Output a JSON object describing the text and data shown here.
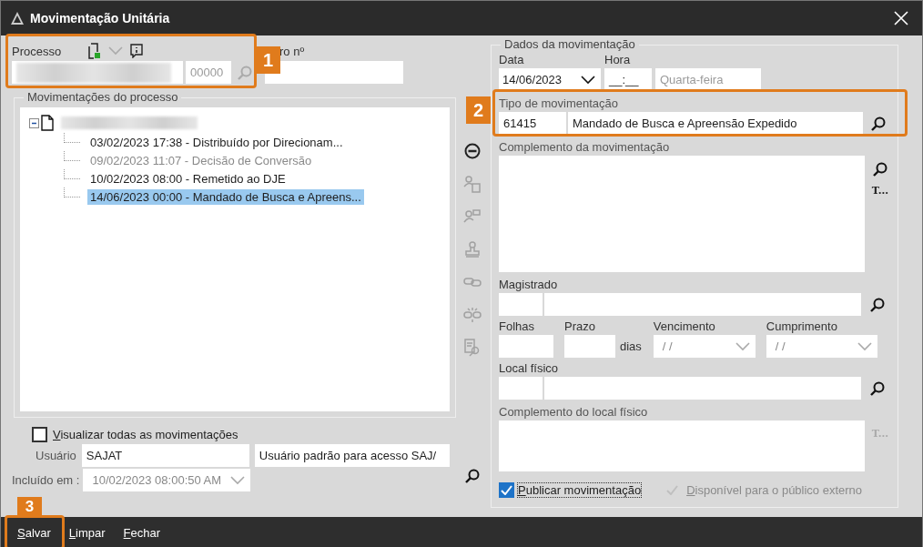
{
  "window": {
    "title": "Movimentação Unitária"
  },
  "processo": {
    "label": "Processo",
    "number_suffix": "00000",
    "outro_label": "ro nº",
    "annotation": "1"
  },
  "movimentacoes": {
    "title": "Movimentações do processo",
    "expanded": true,
    "items": [
      {
        "text": "03/02/2023 17:38 - Distribuído por Direcionam...",
        "selected": false,
        "disabled": false
      },
      {
        "text": "09/02/2023 11:07 - Decisão de Conversão",
        "selected": false,
        "disabled": true
      },
      {
        "text": "10/02/2023 08:00 - Remetido ao DJE",
        "selected": false,
        "disabled": false
      },
      {
        "text": "14/06/2023 00:00 - Mandado de Busca e Apreens...",
        "selected": true,
        "disabled": false
      }
    ]
  },
  "visualizar_todas": {
    "label": "Visualizar todas as movimentações",
    "checked": false
  },
  "usuario": {
    "label": "Usuário",
    "code": "SAJAT",
    "name": "Usuário padrão para acesso SAJ/"
  },
  "incluido": {
    "label": "Incluído em :",
    "value": "10/02/2023 08:00:50 AM"
  },
  "side_tools": [
    {
      "kind": "remove",
      "disabled": false
    },
    {
      "kind": "person-doc",
      "disabled": true
    },
    {
      "kind": "person-flag",
      "disabled": true
    },
    {
      "kind": "stamp",
      "disabled": true
    },
    {
      "kind": "link",
      "disabled": true
    },
    {
      "kind": "unlink",
      "disabled": true
    },
    {
      "kind": "doc-search",
      "disabled": true
    }
  ],
  "dados": {
    "title": "Dados da movimentação",
    "data_label": "Data",
    "data": "14/06/2023",
    "hora_label": "Hora",
    "hora": "__:__",
    "weekday": "Quarta-feira",
    "tipo": {
      "label": "Tipo de movimentação",
      "code": "61415",
      "name": "Mandado de Busca e Apreensão Expedido",
      "annotation": "2"
    },
    "complemento_label": "Complemento da movimentação",
    "complemento_text_button": "T...",
    "magistrado_label": "Magistrado",
    "folhas_label": "Folhas",
    "prazo_label": "Prazo",
    "dias": "dias",
    "vencimento_label": "Vencimento",
    "vencimento": "/ /",
    "cumprimento_label": "Cumprimento",
    "cumprimento": "/ /",
    "local_label": "Local físico",
    "complemento_local_label": "Complemento do local físico",
    "complemento_local_text_button": "T...",
    "complemento_local_text_disabled": true,
    "publicar": {
      "label": "Publicar movimentação",
      "checked": true
    },
    "disponivel": {
      "label": "Disponível para o público externo",
      "checked": true,
      "disabled": true
    }
  },
  "footer": {
    "annotation": "3",
    "buttons": [
      {
        "label": "Salvar"
      },
      {
        "label": "Limpar"
      },
      {
        "label": "Fechar"
      }
    ]
  }
}
